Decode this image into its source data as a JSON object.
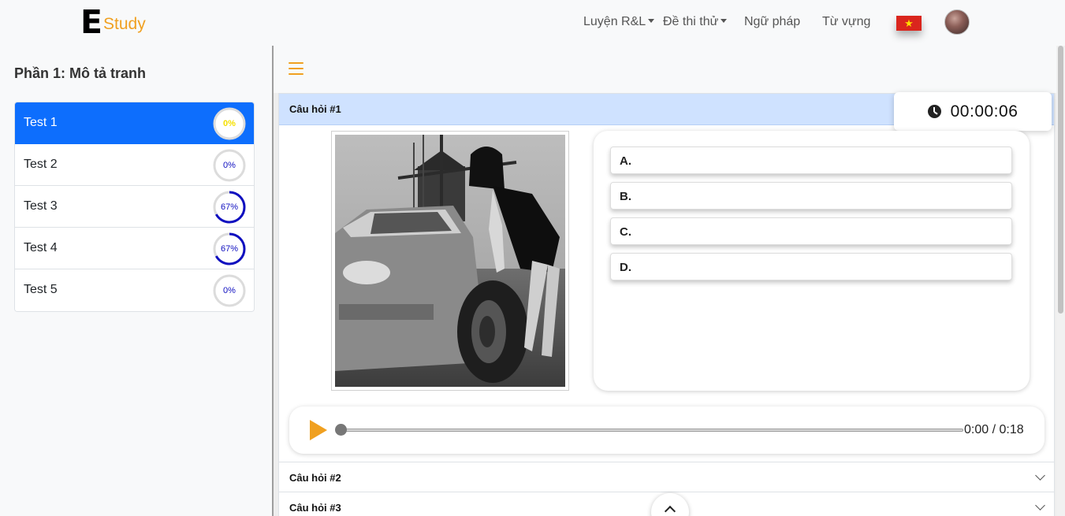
{
  "brand": {
    "logo_letter": "E",
    "name": "Study"
  },
  "nav": {
    "items": [
      {
        "label": "Luyện R&L",
        "dropdown": true
      },
      {
        "label": "Đề thi thử",
        "dropdown": true
      },
      {
        "label": "Ngữ pháp",
        "dropdown": false
      },
      {
        "label": "Từ vựng",
        "dropdown": false
      }
    ],
    "flag_icon": "vietnam-flag-icon",
    "flag_star": "★"
  },
  "sidebar": {
    "title": "Phần 1: Mô tả tranh",
    "tests": [
      {
        "label": "Test 1",
        "progress": 0,
        "progress_text": "0%",
        "active": true
      },
      {
        "label": "Test 2",
        "progress": 0,
        "progress_text": "0%",
        "active": false
      },
      {
        "label": "Test 3",
        "progress": 0.67,
        "progress_text": "67%",
        "active": false
      },
      {
        "label": "Test 4",
        "progress": 0.67,
        "progress_text": "67%",
        "active": false
      },
      {
        "label": "Test 5",
        "progress": 0,
        "progress_text": "0%",
        "active": false
      }
    ]
  },
  "timer": {
    "value": "00:00:06"
  },
  "questions": [
    {
      "title": "Câu hỏi #1",
      "expanded": true
    },
    {
      "title": "Câu hỏi #2",
      "expanded": false
    },
    {
      "title": "Câu hỏi #3",
      "expanded": false
    }
  ],
  "answers": [
    "A.",
    "B.",
    "C.",
    "D."
  ],
  "audio": {
    "time": "0:00 / 0:18",
    "progress": 0
  },
  "colors": {
    "accent": "#f0a020",
    "active": "#0d6efd",
    "progress": "#1010c0",
    "header": "#cfe2ff"
  }
}
